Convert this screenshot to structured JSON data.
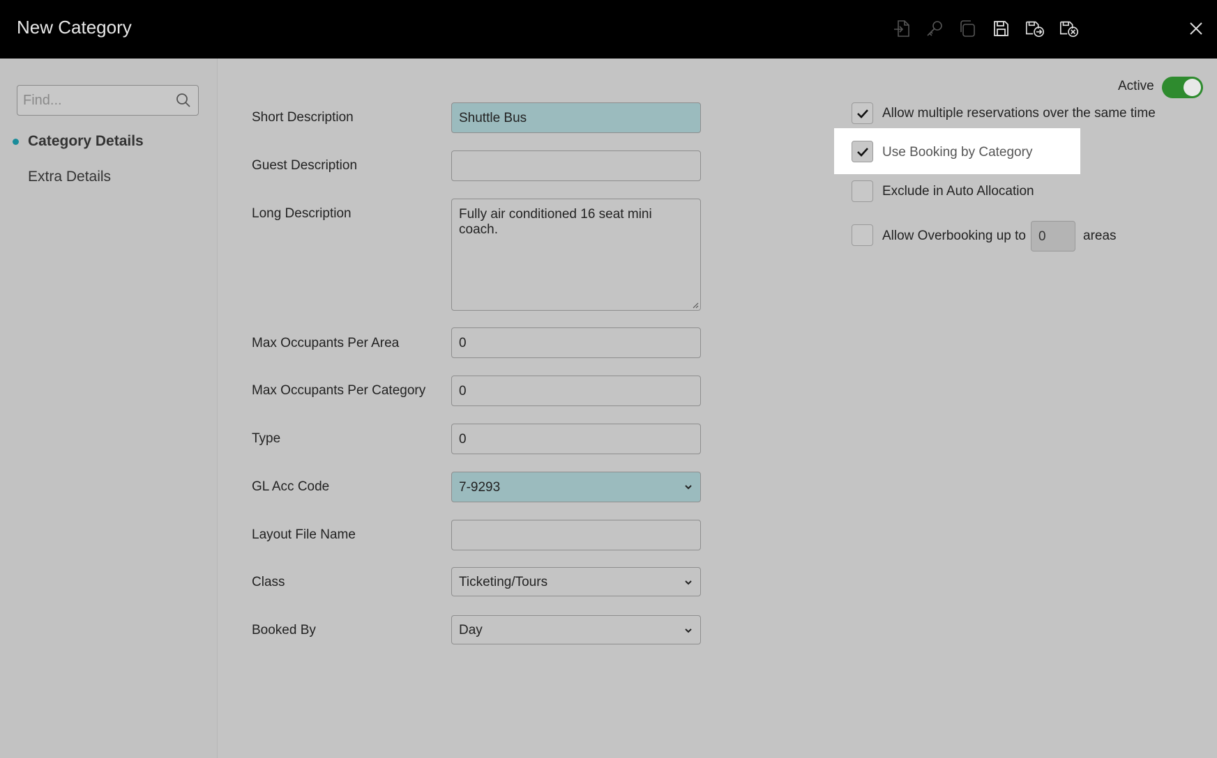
{
  "window": {
    "title": "New Category"
  },
  "toolbar": {
    "icons": [
      "import-icon",
      "key-icon",
      "copy-icon",
      "save-icon",
      "save-and-new-icon",
      "save-and-close-icon",
      "close-icon"
    ]
  },
  "sidebar": {
    "search_placeholder": "Find...",
    "items": [
      {
        "label": "Category Details",
        "active": true
      },
      {
        "label": "Extra Details",
        "active": false
      }
    ]
  },
  "form": {
    "short_description": {
      "label": "Short Description",
      "value": "Shuttle Bus"
    },
    "guest_description": {
      "label": "Guest Description",
      "value": ""
    },
    "long_description": {
      "label": "Long Description",
      "value": "Fully air conditioned 16 seat mini coach."
    },
    "max_occupants_area": {
      "label": "Max Occupants Per Area",
      "value": "0"
    },
    "max_occupants_category": {
      "label": "Max Occupants Per Category",
      "value": "0"
    },
    "type": {
      "label": "Type",
      "value": "0"
    },
    "gl_acc_code": {
      "label": "GL Acc Code",
      "value": "7-9293"
    },
    "layout_file_name": {
      "label": "Layout File Name",
      "value": ""
    },
    "class": {
      "label": "Class",
      "value": "Ticketing/Tours"
    },
    "booked_by": {
      "label": "Booked By",
      "value": "Day"
    }
  },
  "options": {
    "active": {
      "label": "Active",
      "on": true
    },
    "allow_multiple": {
      "label": "Allow multiple reservations over the same time",
      "checked": true
    },
    "use_booking_by_category": {
      "label": "Use Booking by Category",
      "checked": true
    },
    "exclude_auto_allocation": {
      "label": "Exclude in Auto Allocation",
      "checked": false
    },
    "allow_overbooking": {
      "label": "Allow Overbooking up to",
      "checked": false,
      "value": "0",
      "suffix": "areas"
    }
  },
  "colors": {
    "titlebar": "#000000",
    "accent_teal": "#9bbbbe",
    "toggle_green": "#2e8b2e",
    "nav_dot": "#1a8c9a"
  }
}
